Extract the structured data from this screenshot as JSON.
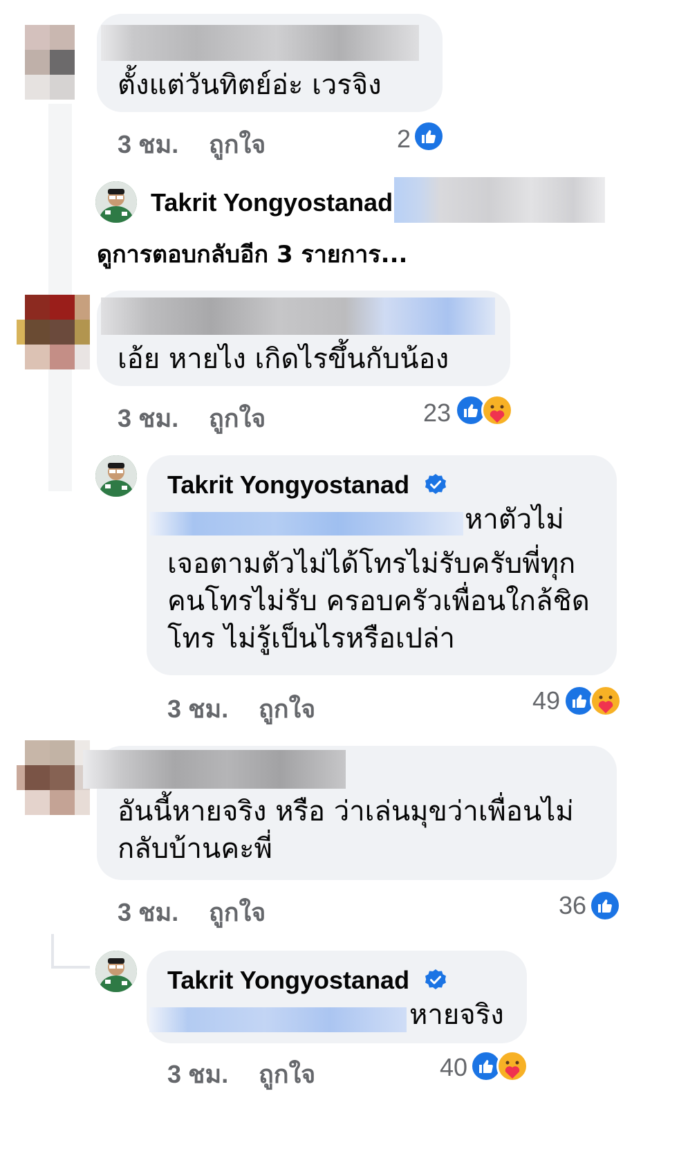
{
  "comments": [
    {
      "text": "ตั้งแต่วันทิตย์อ่ะ เวรจิง",
      "time": "3 ชม.",
      "like_label": "ถูกใจ",
      "reaction_count": "2"
    },
    {
      "text": "เอ้ย หายไง เกิดไรขึ้นกับน้อง",
      "time": "3 ชม.",
      "like_label": "ถูกใจ",
      "reaction_count": "23"
    },
    {
      "text": "อันนี้หายจริง หรือ ว่าเล่นมุขว่าเพื่อนไม่\nกลับบ้านคะพี่",
      "time": "3 ชม.",
      "like_label": "ถูกใจ",
      "reaction_count": "36"
    }
  ],
  "preview_reply": {
    "author": "Takrit Yongyostanad"
  },
  "view_more": "ดูการตอบกลับอีก 3 รายการ...",
  "replies": [
    {
      "author": "Takrit Yongyostanad",
      "text_line1": "หาตัวไม่",
      "text_rest": "เจอตามตัวไม่ได้โทรไม่รับครับพี่ทุก\nคนโทรไม่รับ ครอบครัวเพื่อนใกล้ชิด\nโทร ไม่รู้เป็นไรหรือเปล่า",
      "time": "3 ชม.",
      "like_label": "ถูกใจ",
      "reaction_count": "49"
    },
    {
      "author": "Takrit Yongyostanad",
      "text_line1": "หายจริง",
      "time": "3 ชม.",
      "like_label": "ถูกใจ",
      "reaction_count": "40"
    }
  ],
  "colors": {
    "like_blue": "#1b74e4",
    "verified_blue": "#1b74e4",
    "meta_gray": "#65676b",
    "bubble_bg": "#f0f2f5",
    "love_yellow": "#f7b125"
  },
  "icons": {
    "like": "like-icon",
    "care": "care-icon",
    "verified": "verified-badge-icon"
  }
}
